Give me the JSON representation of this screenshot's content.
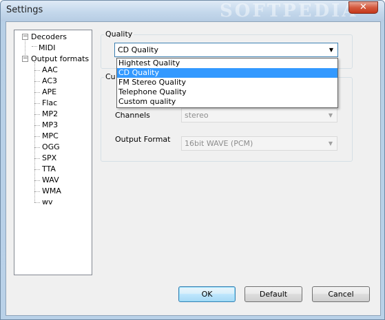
{
  "window": {
    "title": "Settings",
    "watermark": "SOFTPEDIA",
    "close_glyph": "✕"
  },
  "tree": {
    "decoders": {
      "label": "Decoders",
      "expander": "−",
      "children": [
        "MIDI"
      ]
    },
    "output_formats": {
      "label": "Output formats",
      "expander": "−",
      "children": [
        "AAC",
        "AC3",
        "APE",
        "Flac",
        "MP2",
        "MP3",
        "MPC",
        "OGG",
        "SPX",
        "TTA",
        "WAV",
        "WMA",
        "wv"
      ]
    }
  },
  "quality": {
    "group_label": "Quality",
    "selected": "CD Quality",
    "options": [
      "Hightest Quality",
      "CD Quality",
      "FM Stereo Quality",
      "Telephone Quality",
      "Custom quality"
    ],
    "selected_index": 1
  },
  "custom": {
    "group_label": "Cu",
    "channels_label": "Channels",
    "channels_value": "stereo",
    "output_format_label": "Output Format",
    "output_format_value": "16bit WAVE (PCM)"
  },
  "buttons": {
    "ok": "OK",
    "default": "Default",
    "cancel": "Cancel"
  },
  "icons": {
    "combo_arrow": "chevron-down-icon",
    "close": "close-icon"
  },
  "colors": {
    "selection": "#3399ff",
    "title_gradient_top": "#dfeaf6",
    "close_red": "#c4381b",
    "window_frame": "#b9d1e8"
  }
}
